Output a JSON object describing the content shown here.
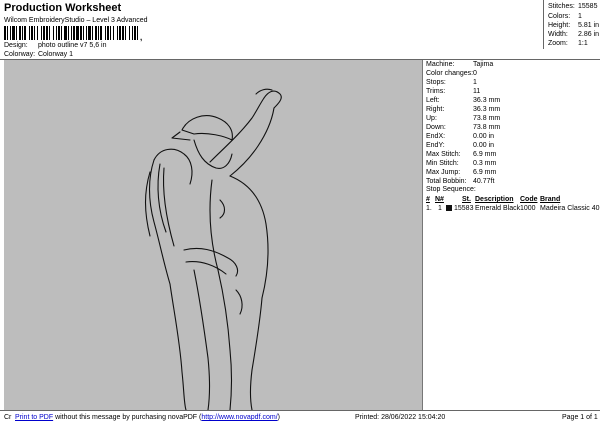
{
  "header": {
    "title": "Production Worksheet",
    "subtitle": "Wilcom EmbroideryStudio – Level 3 Advanced",
    "design_label": "Design:",
    "design_value": "photo outline v7 5,6 in",
    "colorway_label": "Colorway:",
    "colorway_value": "Colorway 1",
    "barcode_tick": ","
  },
  "stats": [
    {
      "label": "Stitches:",
      "value": "15585"
    },
    {
      "label": "Colors:",
      "value": "1"
    },
    {
      "label": "Height:",
      "value": "5.81 in"
    },
    {
      "label": "Width:",
      "value": "2.86 in"
    },
    {
      "label": "Zoom:",
      "value": "1:1"
    }
  ],
  "properties": [
    {
      "label": "Machine:",
      "value": "Tajima"
    },
    {
      "label": "Color changes:",
      "value": "0"
    },
    {
      "label": "Stops:",
      "value": "1"
    },
    {
      "label": "Trims:",
      "value": "11"
    },
    {
      "label": "Left:",
      "value": "36.3 mm"
    },
    {
      "label": "Right:",
      "value": "36.3 mm"
    },
    {
      "label": "Up:",
      "value": "73.8 mm"
    },
    {
      "label": "Down:",
      "value": "73.8 mm"
    },
    {
      "label": "EndX:",
      "value": "0.00 in"
    },
    {
      "label": "EndY:",
      "value": "0.00 in"
    },
    {
      "label": "Max Stitch:",
      "value": "6.9 mm"
    },
    {
      "label": "Min Stitch:",
      "value": "0.3 mm"
    },
    {
      "label": "Max Jump:",
      "value": "6.9 mm"
    },
    {
      "label": "Total Bobbin:",
      "value": "40.77ft"
    }
  ],
  "stop_sequence": {
    "title": "Stop Sequence:",
    "headers": {
      "num": "#",
      "n": "N#",
      "st": "St.",
      "desc": "Description",
      "code": "Code",
      "brand": "Brand"
    },
    "rows": [
      {
        "num": "1.",
        "n": "1",
        "st": "15583",
        "desc": "Emerald Black",
        "code": "1000",
        "brand": "Madeira Classic 40",
        "color": "#111111"
      }
    ]
  },
  "footer": {
    "left_cut": "Cr",
    "promo_link": "Print to PDF",
    "promo_text": " without this message by purchasing novaPDF (",
    "promo_url": "http://www.novapdf.com/",
    "promo_close": ")",
    "printed": "Printed: 28/06/2022 15:04:20",
    "page": "Page 1 of 1"
  },
  "colors": {
    "design_bg": "#bdbdbd",
    "outline": "#111111",
    "link": "#0000cc"
  }
}
